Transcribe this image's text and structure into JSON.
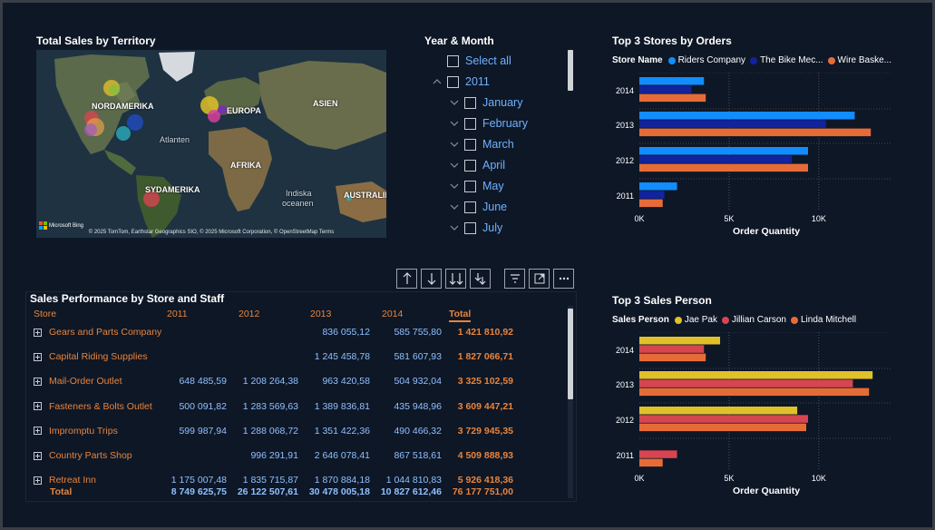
{
  "map": {
    "title": "Total Sales by Territory",
    "labels": {
      "north_america": "NORDAMERIKA",
      "europe": "EUROPA",
      "asia": "ASIEN",
      "atlantic": "Atlanten",
      "africa": "AFRIKA",
      "south_america": "SYDAMERIKA",
      "indian_ocean_1": "Indiska",
      "indian_ocean_2": "oceanen",
      "australia": "AUSTRALIE"
    },
    "logo_text": "Microsoft Bing",
    "attribution": "© 2025 TomTom, Earthstar Geographics SIO, © 2025 Microsoft Corporation, © OpenStreetMap  Terms"
  },
  "slicer": {
    "title": "Year & Month",
    "items": [
      {
        "label": "Select all",
        "level": 0,
        "chevron": "none"
      },
      {
        "label": "2011",
        "level": 0,
        "chevron": "up"
      },
      {
        "label": "January",
        "level": 1,
        "chevron": "down"
      },
      {
        "label": "February",
        "level": 1,
        "chevron": "down"
      },
      {
        "label": "March",
        "level": 1,
        "chevron": "down"
      },
      {
        "label": "April",
        "level": 1,
        "chevron": "down"
      },
      {
        "label": "May",
        "level": 1,
        "chevron": "down"
      },
      {
        "label": "June",
        "level": 1,
        "chevron": "down"
      },
      {
        "label": "July",
        "level": 1,
        "chevron": "down"
      }
    ]
  },
  "table": {
    "title": "Sales Performance by Store and Staff",
    "toolbar": [
      "drill-up-icon",
      "drill-down-icon",
      "expand-all-icon",
      "expand-next-level-icon",
      "filter-icon",
      "focus-mode-icon",
      "more-options-icon"
    ],
    "headers": [
      "Store",
      "2011",
      "2012",
      "2013",
      "2014",
      "Total"
    ],
    "rows": [
      {
        "store": "Gears and Parts Company",
        "y2011": "",
        "y2012": "",
        "y2013": "836 055,12",
        "y2014": "585 755,80",
        "total": "1 421 810,92"
      },
      {
        "store": "Capital Riding Supplies",
        "y2011": "",
        "y2012": "",
        "y2013": "1 245 458,78",
        "y2014": "581 607,93",
        "total": "1 827 066,71"
      },
      {
        "store": "Mail-Order Outlet",
        "y2011": "648 485,59",
        "y2012": "1 208 264,38",
        "y2013": "963 420,58",
        "y2014": "504 932,04",
        "total": "3 325 102,59"
      },
      {
        "store": "Fasteners & Bolts Outlet",
        "y2011": "500 091,82",
        "y2012": "1 283 569,63",
        "y2013": "1 389 836,81",
        "y2014": "435 948,96",
        "total": "3 609 447,21"
      },
      {
        "store": "Impromptu Trips",
        "y2011": "599 987,94",
        "y2012": "1 288 068,72",
        "y2013": "1 351 422,36",
        "y2014": "490 466,32",
        "total": "3 729 945,35"
      },
      {
        "store": "Country Parts Shop",
        "y2011": "",
        "y2012": "996 291,91",
        "y2013": "2 646 078,41",
        "y2014": "867 518,61",
        "total": "4 509 888,93"
      },
      {
        "store": "Retreat Inn",
        "y2011": "1 175 007,48",
        "y2012": "1 835 715,87",
        "y2013": "1 870 884,18",
        "y2014": "1 044 810,83",
        "total": "5 926 418,36"
      }
    ],
    "totals": {
      "store": "Total",
      "y2011": "8 749 625,75",
      "y2012": "26 122 507,61",
      "y2013": "30 478 005,18",
      "y2014": "10 827 612,46",
      "total": "76 177 751,00"
    }
  },
  "chart_data": [
    {
      "type": "bar",
      "orientation": "horizontal",
      "title": "Top 3 Stores by Orders",
      "legend_title": "Store Name",
      "legend_placement": "top-left",
      "categories": [
        "2014",
        "2013",
        "2012",
        "2011"
      ],
      "series": [
        {
          "name": "Riders Company",
          "color": "#118dff",
          "values": [
            3600,
            12000,
            9400,
            2100
          ]
        },
        {
          "name": "The Bike Mec...",
          "color": "#12239e",
          "values": [
            2900,
            10400,
            8500,
            1400
          ]
        },
        {
          "name": "Wire Baske...",
          "color": "#e66c37",
          "values": [
            3700,
            12900,
            9400,
            1300
          ]
        }
      ],
      "xlabel": "Order Quantity",
      "xticks": [
        "0K",
        "5K",
        "10K"
      ],
      "xlim": [
        0,
        14000
      ],
      "grid": true
    },
    {
      "type": "bar",
      "orientation": "horizontal",
      "title": "Top 3 Sales Person",
      "legend_title": "Sales Person",
      "legend_placement": "top-left",
      "categories": [
        "2014",
        "2013",
        "2012",
        "2011"
      ],
      "series": [
        {
          "name": "Jae Pak",
          "color": "#e0c12a",
          "values": [
            4500,
            13000,
            8800,
            0
          ]
        },
        {
          "name": "Jillian Carson",
          "color": "#d64550",
          "values": [
            3600,
            11900,
            9400,
            2100
          ]
        },
        {
          "name": "Linda Mitchell",
          "color": "#e66c37",
          "values": [
            3700,
            12800,
            9300,
            1300
          ]
        }
      ],
      "xlabel": "Order Quantity",
      "xticks": [
        "0K",
        "5K",
        "10K"
      ],
      "xlim": [
        0,
        14000
      ],
      "grid": true
    }
  ]
}
